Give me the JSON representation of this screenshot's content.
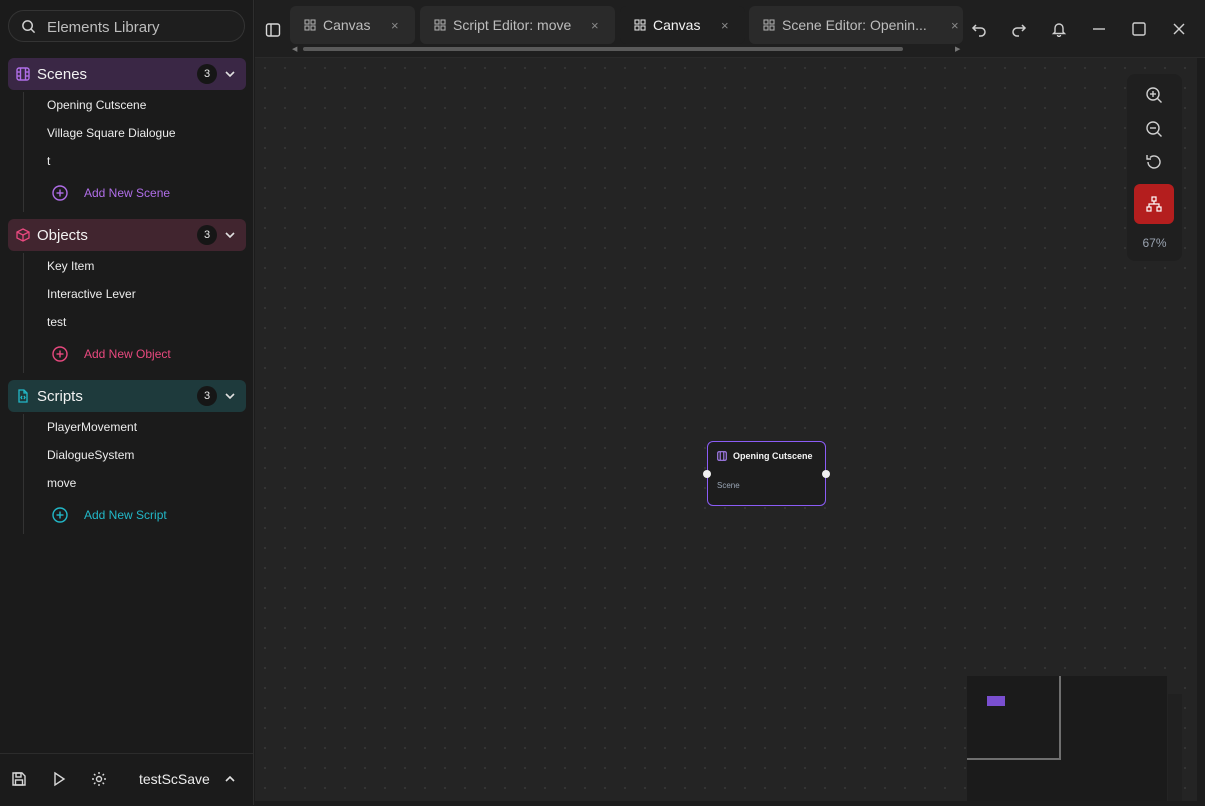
{
  "sidebar": {
    "search": {
      "placeholder": "Elements Library",
      "value": ""
    },
    "sections": [
      {
        "title": "Scenes",
        "count": "3",
        "color": "#b06ee8",
        "items": [
          "Opening Cutscene",
          "Village Square Dialogue",
          "t"
        ],
        "add_label": "Add New Scene"
      },
      {
        "title": "Objects",
        "count": "3",
        "color": "#e8497f",
        "items": [
          "Key Item",
          "Interactive Lever",
          "test"
        ],
        "add_label": "Add New Object"
      },
      {
        "title": "Scripts",
        "count": "3",
        "color": "#22b8c8",
        "items": [
          "PlayerMovement",
          "DialogueSystem",
          "move"
        ],
        "add_label": "Add New Script"
      }
    ],
    "footer": {
      "project_name": "testScSave"
    }
  },
  "tabs": [
    {
      "label": "Canvas",
      "active": false
    },
    {
      "label": "Script Editor: move",
      "active": false
    },
    {
      "label": "Canvas",
      "active": true
    },
    {
      "label": "Scene Editor: Openin...",
      "active": false
    }
  ],
  "tab_close_glyph": "×",
  "canvas": {
    "zoom_level": "67%",
    "node": {
      "title": "Opening Cutscene",
      "type": "Scene",
      "border_color": "#8b5cf6"
    },
    "layout_button_color": "#b41e1e"
  },
  "icons": {
    "sidebar_toggle": "sidebar-toggle-icon",
    "undo": "undo-icon",
    "redo": "redo-icon",
    "bell": "bell-icon",
    "minimize": "minimize-icon",
    "maximize": "maximize-icon",
    "close": "close-icon",
    "save": "save-icon",
    "play": "play-icon",
    "settings": "gear-icon"
  }
}
